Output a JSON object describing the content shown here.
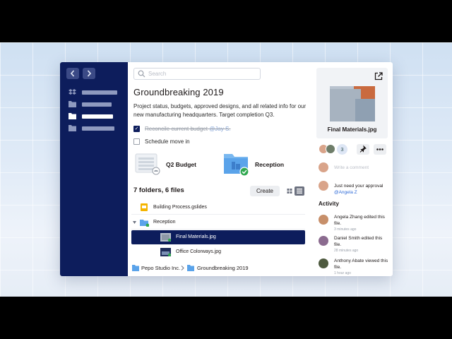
{
  "colors": {
    "sidebar": "#0d1d5c",
    "accent": "#0061fe",
    "mention": "#2f6bd8"
  },
  "sidebar": {
    "back_icon": "chevron-left-icon",
    "forward_icon": "chevron-right-icon",
    "items": [
      {
        "icon": "dropbox-icon"
      },
      {
        "icon": "folder-icon"
      },
      {
        "icon": "folder-icon",
        "active": true
      },
      {
        "icon": "folder-icon"
      }
    ]
  },
  "search": {
    "placeholder": "Search"
  },
  "page": {
    "title": "Groundbreaking 2019",
    "description": "Project status, budgets, approved designs, and all related info for our new manufacturing headquarters. Target completion Q3."
  },
  "tasks": [
    {
      "label": "Reconcile current budget",
      "mention": "@Jay S.",
      "done": true
    },
    {
      "label": "Schedule move in",
      "done": false
    }
  ],
  "cards": [
    {
      "label": "Q2 Budget",
      "icon": "spreadsheet-icon"
    },
    {
      "label": "Reception",
      "icon": "folder-shared-icon"
    }
  ],
  "files": {
    "count_label": "7 folders, 6 files",
    "create_label": "Create",
    "rows": [
      {
        "name": "Building Process.gslides",
        "icon": "slides-icon"
      },
      {
        "name": "Reception",
        "icon": "folder-icon",
        "expanded": true
      },
      {
        "name": "Final Materials.jpg",
        "icon": "image-icon",
        "selected": true
      },
      {
        "name": "Office Colorways.jpg",
        "icon": "image-icon"
      }
    ]
  },
  "breadcrumb": {
    "root": "Pepo Studio Inc.",
    "current": "Groundbreaking 2019"
  },
  "preview": {
    "filename": "Final Materials.jpg",
    "open_icon": "open-external-icon"
  },
  "sharing": {
    "extra_count": "3"
  },
  "comments": {
    "placeholder": "Write a comment",
    "items": [
      {
        "text": "Just need your approval",
        "mention": "@Angela Z"
      }
    ]
  },
  "activity": {
    "heading": "Activity",
    "items": [
      {
        "text": "Angela Zhang edited this file.",
        "time": "3 minutes ago"
      },
      {
        "text": "Daniel Smith edited this file.",
        "time": "28 minutes ago"
      },
      {
        "text": "Anthony Abate viewed this file.",
        "time": "1 hour ago"
      }
    ]
  }
}
